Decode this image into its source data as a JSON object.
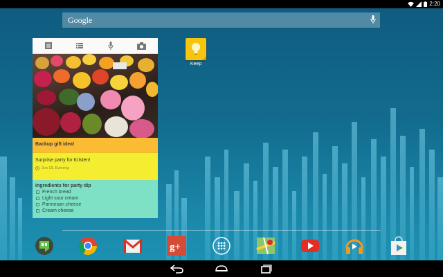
{
  "status_bar": {
    "time": "2:20",
    "icons": [
      "wifi-icon",
      "signal-icon",
      "battery-icon"
    ]
  },
  "search_bar": {
    "logo_text": "Google",
    "icons": [
      "mic-icon"
    ]
  },
  "keep_widget": {
    "toolbar_icons": [
      "text-note-icon",
      "list-note-icon",
      "voice-note-icon",
      "camera-icon"
    ],
    "notes": [
      {
        "title": "Backup gift idea!",
        "color": "#fbbc34"
      },
      {
        "body": "Surprise party for Kristen!",
        "reminder": "Jun 19, Evening",
        "color": "#f4ed30"
      },
      {
        "title": "Ingredients for party dip",
        "items": [
          "French bread",
          "Light  sour cream",
          "Parmesan cheese",
          "Cream cheese"
        ],
        "color": "#7ee0c4"
      }
    ]
  },
  "home_apps": [
    {
      "label": "Keep",
      "icon": "keep-lightbulb-icon",
      "color": "#f6c510"
    }
  ],
  "dock_apps": [
    {
      "icon": "hangouts-icon"
    },
    {
      "icon": "chrome-icon"
    },
    {
      "icon": "gmail-icon"
    },
    {
      "icon": "google-plus-icon"
    },
    {
      "icon": "app-drawer-icon"
    },
    {
      "icon": "maps-icon"
    },
    {
      "icon": "youtube-icon"
    },
    {
      "icon": "play-music-icon"
    },
    {
      "icon": "play-store-icon"
    }
  ],
  "nav_bar": {
    "buttons": [
      "back-icon",
      "home-icon",
      "recent-apps-icon"
    ]
  }
}
